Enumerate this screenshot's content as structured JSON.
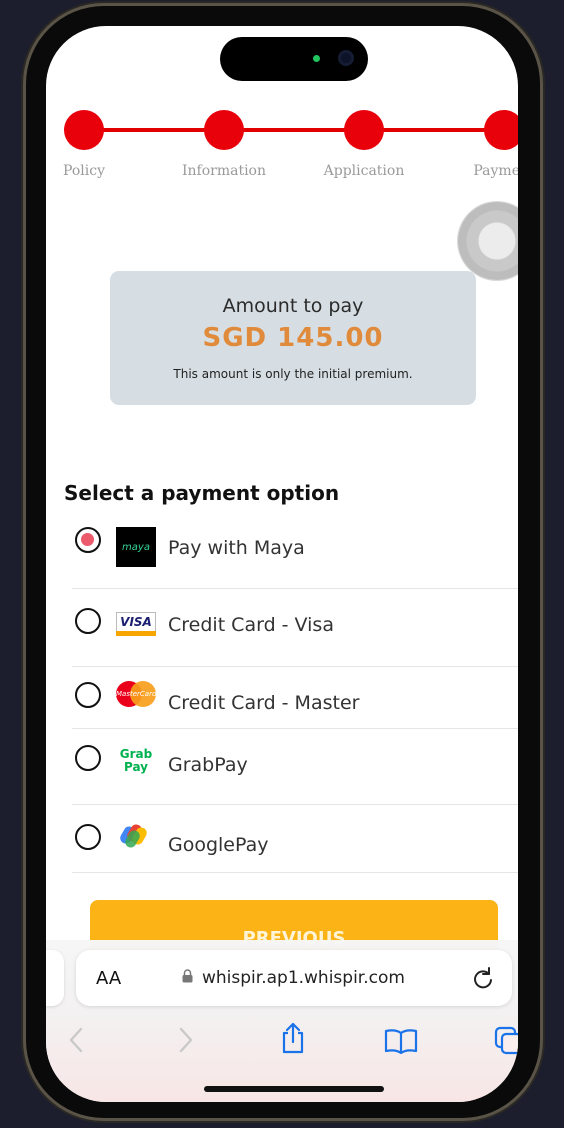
{
  "stepper": {
    "steps": [
      {
        "label": "Policy"
      },
      {
        "label": "Information"
      },
      {
        "label": "Application"
      },
      {
        "label": "Payment"
      }
    ],
    "color": "#e8000a"
  },
  "amount": {
    "title": "Amount to pay",
    "value": "SGD 145.00",
    "note": "This amount is only the initial premium.",
    "value_color": "#e08a3b"
  },
  "payment": {
    "heading": "Select a payment option",
    "options": [
      {
        "label": "Pay with Maya",
        "logo_text": "maya",
        "icon": "maya-logo-icon",
        "selected": true
      },
      {
        "label": "Credit Card - Visa",
        "logo_text": "VISA",
        "icon": "visa-logo-icon",
        "selected": false
      },
      {
        "label": "Credit Card - Master",
        "logo_text": "MasterCard",
        "icon": "mastercard-logo-icon",
        "selected": false
      },
      {
        "label": "GrabPay",
        "logo_text": "Grab Pay",
        "icon": "grabpay-logo-icon",
        "selected": false
      },
      {
        "label": "GooglePay",
        "icon": "googlepay-logo-icon",
        "selected": false
      }
    ]
  },
  "previous_button": {
    "label": "PREVIOUS",
    "color": "#fbb315"
  },
  "browser": {
    "text_size_label": "AA",
    "url": "whispir.ap1.whispir.com",
    "icons": [
      "lock-icon",
      "reload-icon",
      "back-icon",
      "forward-icon",
      "share-icon",
      "bookmarks-icon",
      "tabs-icon"
    ]
  }
}
